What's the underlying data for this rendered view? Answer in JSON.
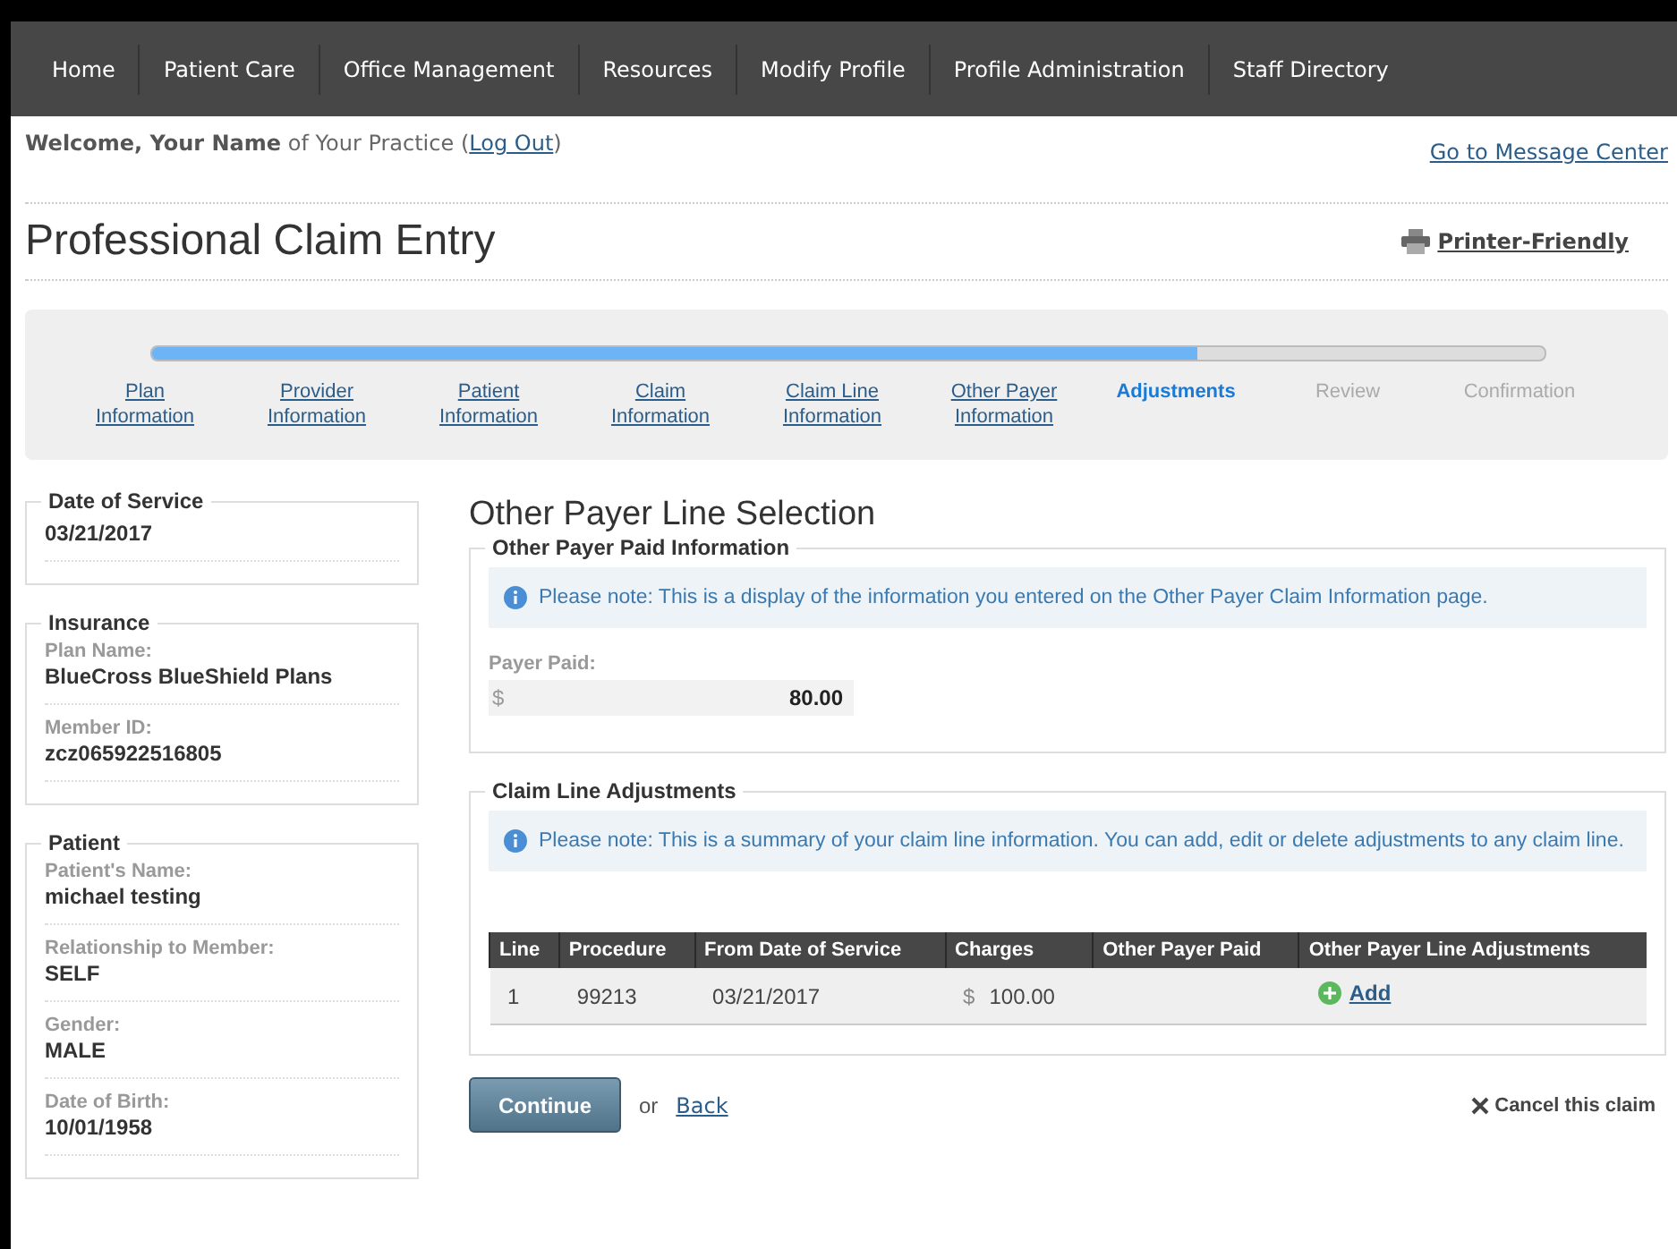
{
  "nav": [
    {
      "label": "Home"
    },
    {
      "label": "Patient Care"
    },
    {
      "label": "Office Management"
    },
    {
      "label": "Resources"
    },
    {
      "label": "Modify Profile"
    },
    {
      "label": "Profile Administration"
    },
    {
      "label": "Staff Directory"
    }
  ],
  "welcome": {
    "text": "**Welcome, Your Name** of Your Practice",
    "logout_open": "(",
    "logout": "Log Out",
    "logout_close": ")",
    "message_center": "Go to Message Center"
  },
  "title": "Professional Claim Entry",
  "printer_friendly": "Printer-Friendly",
  "progress": {
    "level": 0.75,
    "steps": [
      {
        "lines": [
          "Plan",
          "Information"
        ],
        "completed": true,
        "selected": false
      },
      {
        "lines": [
          "Provider",
          "Information"
        ],
        "completed": true,
        "selected": false
      },
      {
        "lines": [
          "Patient",
          "Information"
        ],
        "completed": true,
        "selected": false
      },
      {
        "lines": [
          "Claim",
          "Information"
        ],
        "completed": true,
        "selected": false
      },
      {
        "lines": [
          "Claim Line",
          "Information"
        ],
        "completed": true,
        "selected": false
      },
      {
        "lines": [
          "Other Payer",
          "Information"
        ],
        "completed": true,
        "selected": false
      },
      {
        "lines": [
          "Adjustments"
        ],
        "completed": false,
        "selected": true
      },
      {
        "lines": [
          "Review"
        ],
        "completed": false,
        "selected": false
      },
      {
        "lines": [
          "Confirmation"
        ],
        "completed": false,
        "selected": false
      }
    ]
  },
  "sidebar": [
    {
      "legend": "Date of Service",
      "fields": [
        {
          "value": "03/21/2017"
        }
      ]
    },
    {
      "legend": "Insurance",
      "fields": [
        {
          "label": "Plan Name:",
          "value": "BlueCross BlueShield Plans"
        },
        {
          "label": "Member ID:",
          "value": "zcz065922516805"
        }
      ]
    },
    {
      "legend": "Patient",
      "fields": [
        {
          "label": "Patient's Name:",
          "value": "michael testing"
        },
        {
          "label": "Relationship to Member:",
          "value": "SELF"
        },
        {
          "label": "Gender:",
          "value": "MALE"
        },
        {
          "label": "Date of Birth:",
          "value": "10/01/1958"
        }
      ]
    }
  ],
  "main": {
    "heading": "Other Payer Line Selection",
    "paid_info": {
      "legend": "Other Payer Paid Information",
      "note": "Please note: This is a display of the information you entered on the Other Payer Claim Information page.",
      "payer_paid_label": "Payer Paid:",
      "currency": "$",
      "payer_paid_value": "80.00"
    },
    "adjustments": {
      "legend": "Claim Line Adjustments",
      "note": "Please note: This is a summary of your claim line information. You can add, edit or delete adjustments to any claim line.",
      "table": {
        "columns": [
          "Line",
          "Procedure",
          "From Date of Service",
          "Charges",
          "Other Payer Paid",
          "Other Payer Line Adjustments"
        ],
        "rows": [
          {
            "line": "1",
            "procedure": "99213",
            "from_date": "03/21/2017",
            "charges_currency": "$",
            "charges": "100.00",
            "add": "Add"
          }
        ]
      }
    }
  },
  "actions": {
    "continue": "Continue",
    "or": "or",
    "back": "Back",
    "cancel": "Cancel this claim"
  }
}
